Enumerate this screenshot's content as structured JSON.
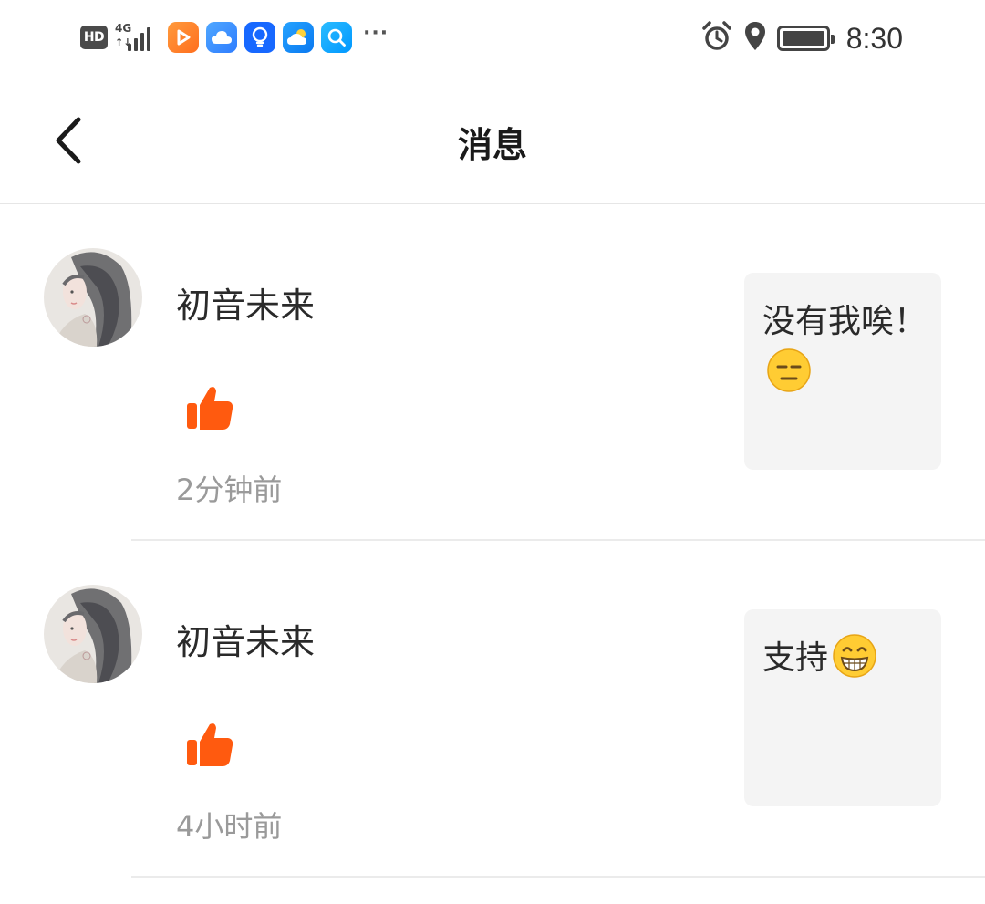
{
  "status_bar": {
    "hd": "HD",
    "network": "4G",
    "network_arrows": "↑↓",
    "more": "···",
    "time": "8:30",
    "icons": [
      "hd-icon",
      "signal-icon",
      "video-app-icon",
      "cloud-app-icon",
      "bulb-app-icon",
      "weather-app-icon",
      "search-app-icon",
      "alarm-icon",
      "location-icon",
      "battery-icon"
    ]
  },
  "header": {
    "title": "消息",
    "back_icon": "chevron-left-icon"
  },
  "messages": [
    {
      "name": "初音未来",
      "action_icon": "thumbs-up-icon",
      "time_ago": "2分钟前",
      "quote_text": "没有我唉！",
      "quote_emoji": "expressionless-face"
    },
    {
      "name": "初音未来",
      "action_icon": "thumbs-up-icon",
      "time_ago": "4小时前",
      "quote_text": "支持",
      "quote_emoji": "grinning-face"
    }
  ],
  "colors": {
    "like": "#ff5a0f",
    "quote_bg": "#f4f4f4",
    "muted_text": "#9a9a9a",
    "divider": "#ebebeb"
  }
}
